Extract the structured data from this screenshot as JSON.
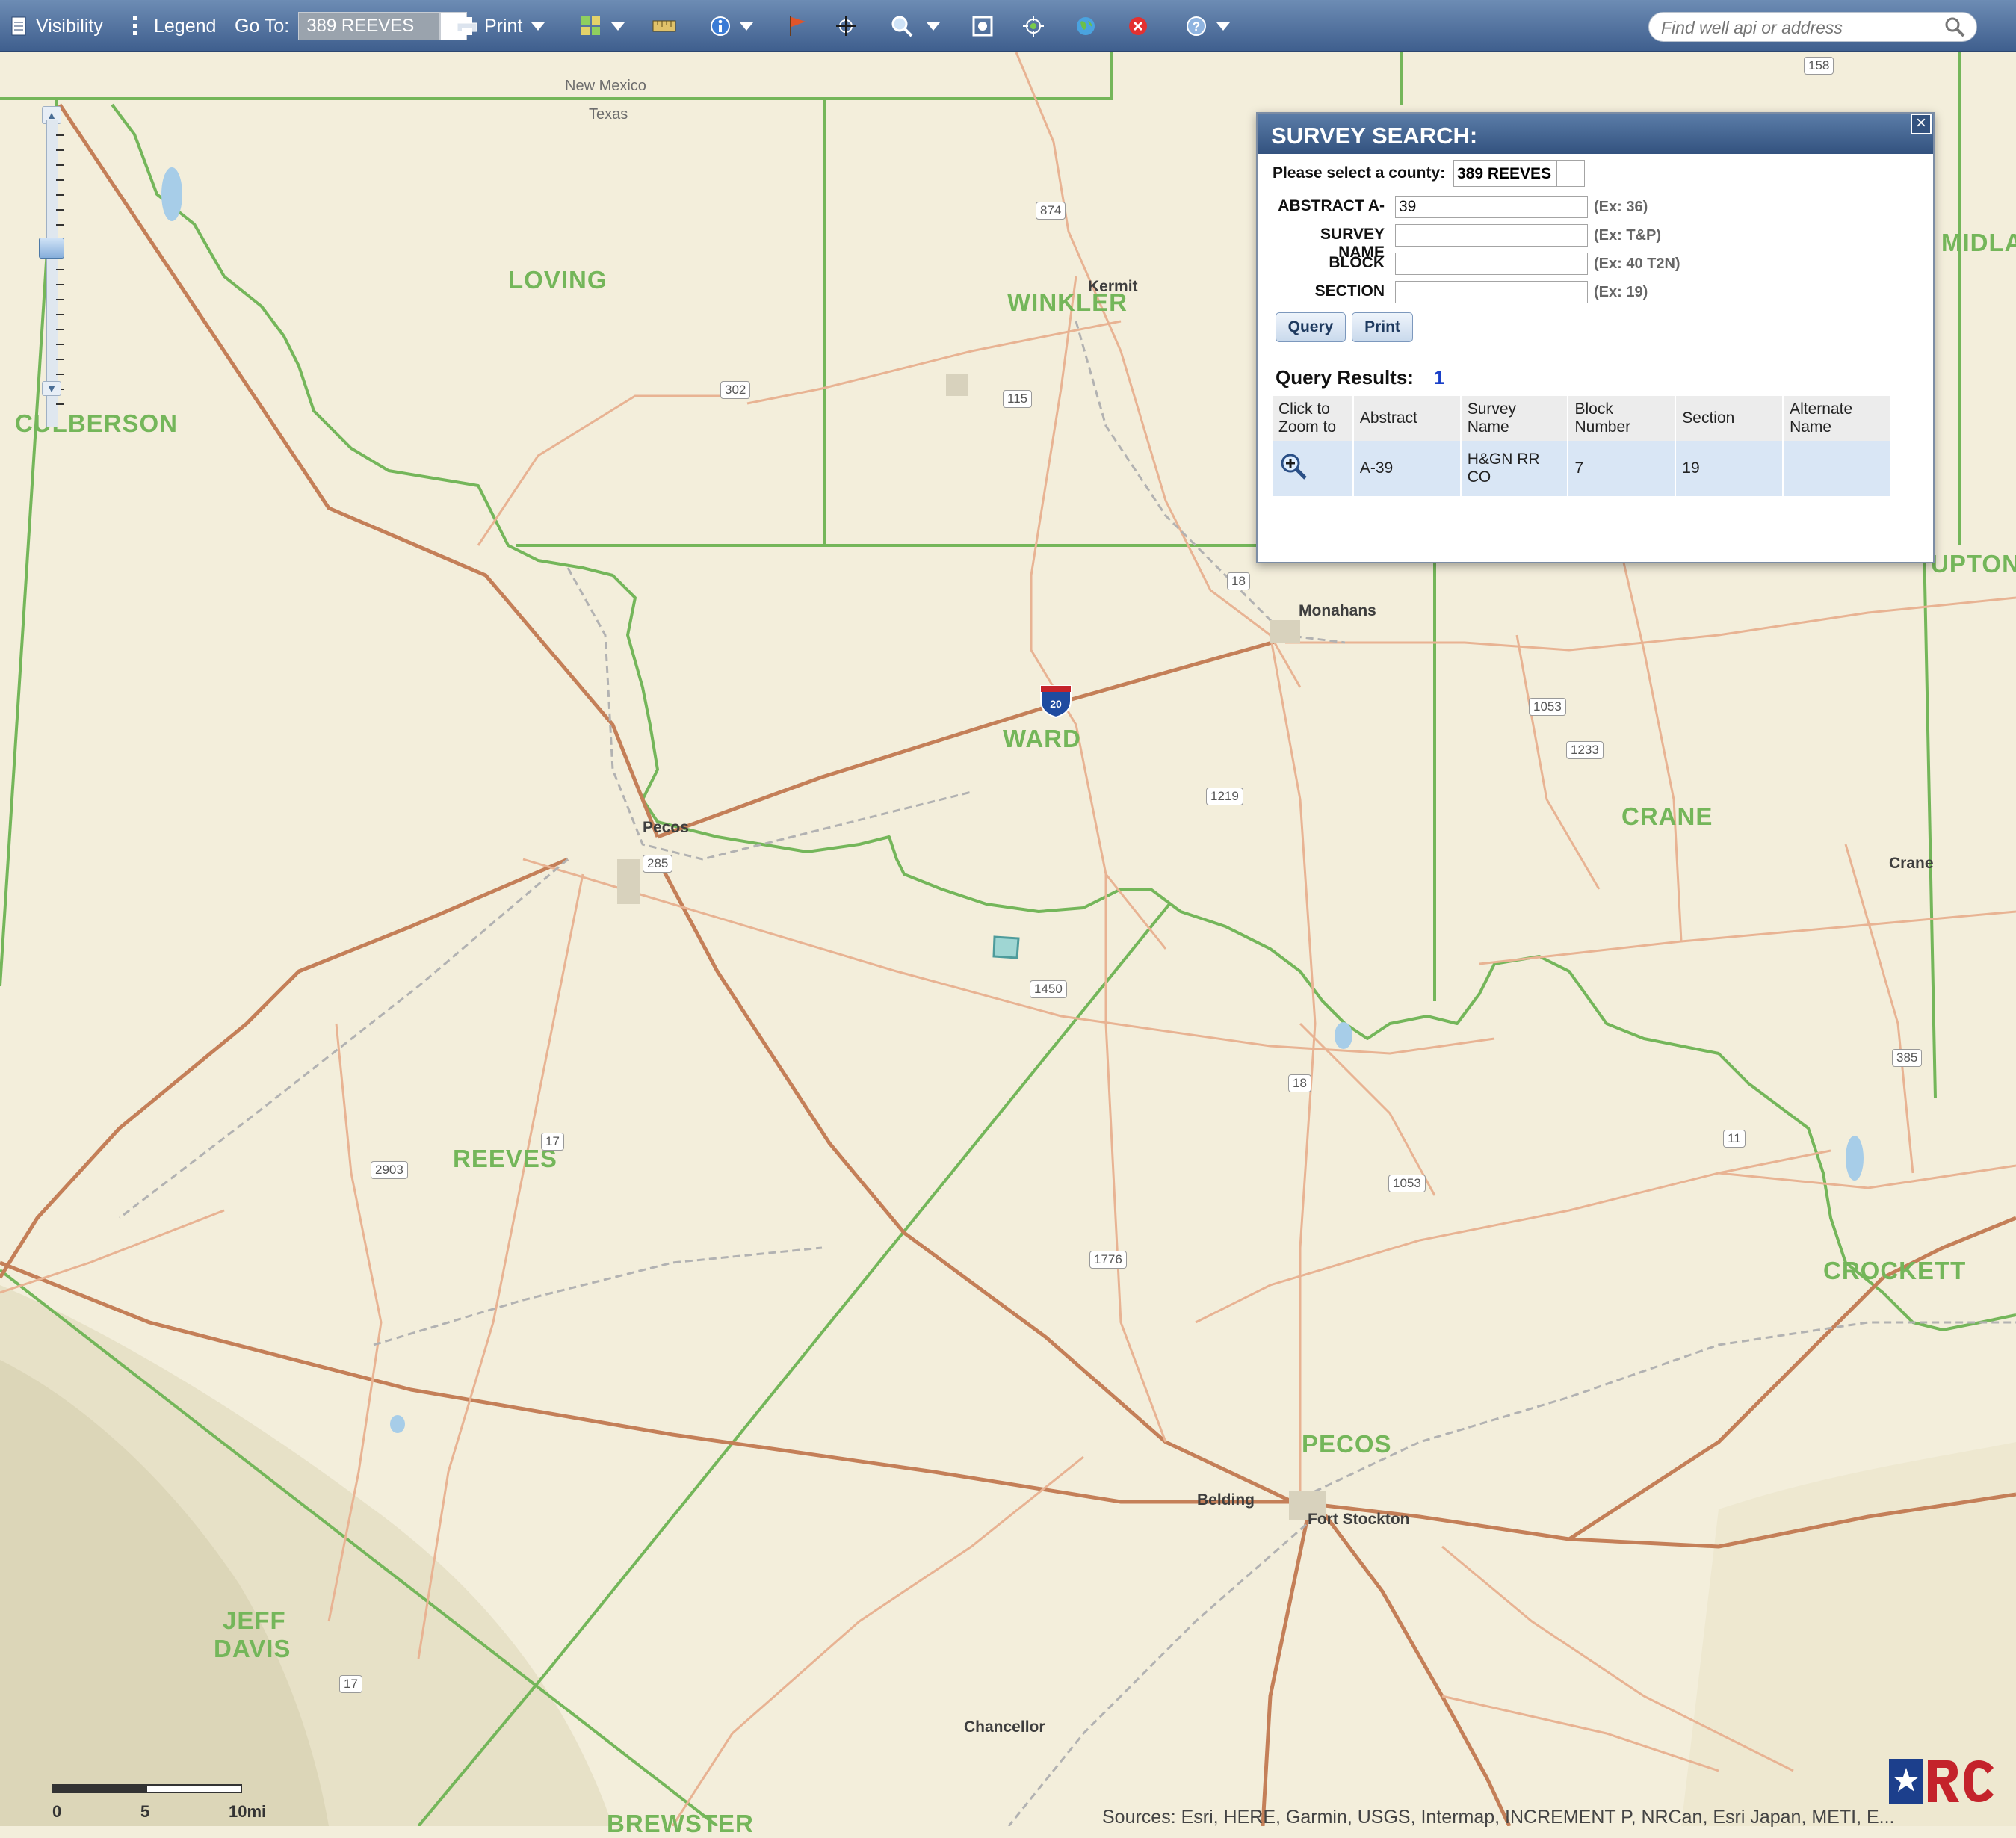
{
  "toolbar": {
    "visibility_label": "Visibility",
    "legend_label": "Legend",
    "goto_label": "Go To:",
    "goto_value": "389 REEVES",
    "print_label": "Print",
    "search_placeholder": "Find well api or address"
  },
  "map": {
    "states": [
      "New Mexico",
      "Texas"
    ],
    "counties": [
      "LOVING",
      "WINKLER",
      "CULBERSON",
      "WARD",
      "CRANE",
      "REEVES",
      "PECOS",
      "JEFF",
      "DAVIS",
      "CROCKETT",
      "UPTON",
      "MIDLAND",
      "BREWSTER"
    ],
    "cities": [
      "Kermit",
      "Monahans",
      "Pecos",
      "Crane",
      "Belding",
      "Fort Stockton",
      "Chancellor"
    ],
    "road_shields": [
      "158",
      "874",
      "302",
      "115",
      "18",
      "20",
      "1053",
      "1233",
      "1219",
      "285",
      "1450",
      "385",
      "18",
      "11",
      "17",
      "2903",
      "1053",
      "1776",
      "17"
    ],
    "scale": {
      "ticks": [
        "0",
        "5",
        "10mi"
      ]
    },
    "attribution": "Sources: Esri, HERE, Garmin, USGS, Intermap, INCREMENT P, NRCan, Esri Japan, METI, E..."
  },
  "survey_search": {
    "title": "SURVEY SEARCH:",
    "county_label": "Please select a county:",
    "county_value": "389 REEVES",
    "fields": [
      {
        "label": "ABSTRACT A-",
        "value": "39",
        "hint": "(Ex: 36)"
      },
      {
        "label": "SURVEY NAME",
        "value": "",
        "hint": "(Ex: T&P)"
      },
      {
        "label": "BLOCK",
        "value": "",
        "hint": "(Ex: 40 T2N)"
      },
      {
        "label": "SECTION",
        "value": "",
        "hint": "(Ex: 19)"
      }
    ],
    "query_label": "Query",
    "print_label": "Print",
    "results_label": "Query Results:",
    "results_count": "1",
    "columns": [
      "Click to Zoom to",
      "Abstract",
      "Survey Name",
      "Block Number",
      "Section",
      "Alternate Name"
    ],
    "rows": [
      {
        "abstract": "A-39",
        "survey_name": "H&GN RR CO",
        "block_number": "7",
        "section": "19",
        "alternate_name": ""
      }
    ]
  },
  "colors": {
    "toolbar": "#4f6f9c",
    "map_background": "#f3eedb",
    "county_line": "#74b65a",
    "highway": "#c47f58",
    "road": "#e8b393"
  }
}
